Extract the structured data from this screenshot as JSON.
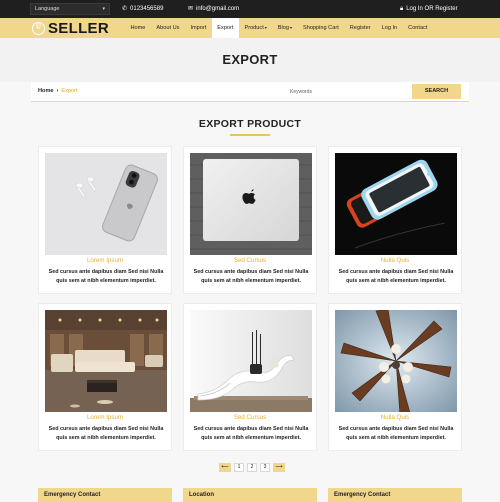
{
  "topbar": {
    "language_label": "Language",
    "phone": "0123456589",
    "email": "info@gmail.com",
    "account": "Log In OR Register",
    "icons": [
      "phone-icon",
      "mail-icon",
      "lock-icon"
    ]
  },
  "nav": {
    "logo": "SELLER",
    "logo_mark": "©",
    "items": [
      {
        "label": "Home"
      },
      {
        "label": "About Us"
      },
      {
        "label": "Import"
      },
      {
        "label": "Export"
      },
      {
        "label": "Product"
      },
      {
        "label": "Blog"
      },
      {
        "label": "Shopping Cart"
      },
      {
        "label": "Register"
      },
      {
        "label": "Log In"
      },
      {
        "label": "Contact"
      }
    ]
  },
  "banner": {
    "title": "EXPORT"
  },
  "breadcrumb": {
    "home": "Home",
    "current": "Export"
  },
  "search": {
    "placeholder": "Keywords",
    "button": "SEARCH"
  },
  "section": {
    "title": "EXPORT PRODUCT"
  },
  "products": [
    {
      "name": "Lorem Ipsum",
      "desc": "Sed cursus ante dapibus diam Sed nisi Nulla quis sem at nibh elementum imperdiet."
    },
    {
      "name": "Sed Cursus",
      "desc": "Sed cursus ante dapibus diam Sed nisi Nulla quis sem at nibh elementum imperdiet."
    },
    {
      "name": "Nulla Quis",
      "desc": "Sed cursus ante dapibus diam Sed nisi Nulla quis sem at nibh elementum imperdiet."
    },
    {
      "name": "Lorem Ipsum",
      "desc": "Sed cursus ante dapibus diam Sed nisi Nulla quis sem at nibh elementum imperdiet."
    },
    {
      "name": "Sed Cursus",
      "desc": "Sed cursus ante dapibus diam Sed nisi Nulla quis sem at nibh elementum imperdiet."
    },
    {
      "name": "Nulla Quis",
      "desc": "Sed cursus ante dapibus diam Sed nisi Nulla quis sem at nibh elementum imperdiet."
    }
  ],
  "pagination": {
    "pages": [
      "1",
      "2",
      "3"
    ],
    "prev": "⟵",
    "next": "⟶"
  },
  "footer": {
    "headings": [
      "Emergency Contact",
      "Location",
      "Emergency Contact"
    ]
  },
  "colors": {
    "accent": "#f1d78c",
    "accent_text": "#e3b03c",
    "dark": "#1f1f1f"
  }
}
